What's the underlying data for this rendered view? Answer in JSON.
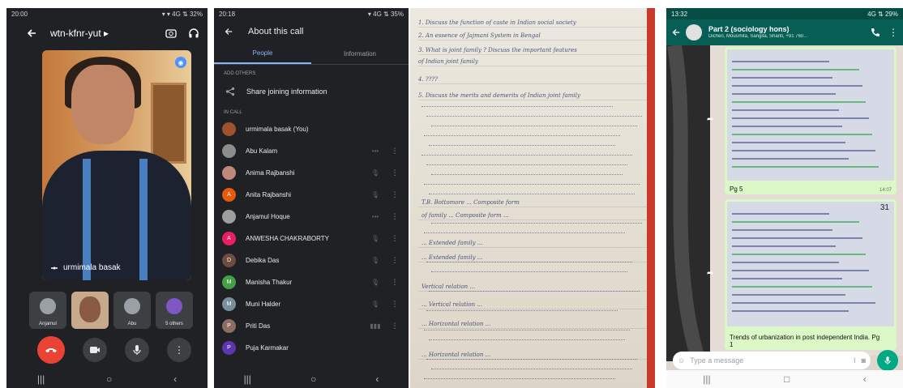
{
  "meet": {
    "status_time": "20:00",
    "status_right": "▾ ▾ 4G ⇅ 32%",
    "title": "wtn-kfnr-yut",
    "title_caret": "▸",
    "presenter_name": "urmimala basak",
    "thumbs": [
      {
        "label": "Anjamul"
      },
      {
        "label": "urmimala"
      },
      {
        "label": "Abu"
      },
      {
        "label": "5 others"
      }
    ]
  },
  "about": {
    "status_time": "20:18",
    "status_right": "▾ 4G ⇅ 35%",
    "title": "About this call",
    "tabs": [
      "People",
      "Information"
    ],
    "section_add": "ADD OTHERS",
    "share_label": "Share joining information",
    "section_incall": "IN CALL",
    "participants": [
      {
        "name": "urmimala basak (You)",
        "initial": "",
        "color": "#a0522d",
        "action": "",
        "menu": ""
      },
      {
        "name": "Abu Kalam",
        "initial": "",
        "color": "#8d8d8d",
        "action": "•••",
        "menu": "⋮"
      },
      {
        "name": "Anima Rajbanshi",
        "initial": "",
        "color": "#c0897a",
        "action": "🎙",
        "menu": "⋮"
      },
      {
        "name": "Anita Rajbanshi",
        "initial": "A",
        "color": "#e8590c",
        "action": "🎙",
        "menu": "⋮"
      },
      {
        "name": "Anjamul Hoque",
        "initial": "",
        "color": "#9e9e9e",
        "action": "•••",
        "menu": "⋮"
      },
      {
        "name": "ANWESHA CHAKRABORTY",
        "initial": "A",
        "color": "#e91e63",
        "action": "🎙",
        "menu": "⋮"
      },
      {
        "name": "Debika Das",
        "initial": "D",
        "color": "#6d4c41",
        "action": "🎙",
        "menu": "⋮"
      },
      {
        "name": "Manisha Thakur",
        "initial": "M",
        "color": "#43a047",
        "action": "🎙",
        "menu": "⋮"
      },
      {
        "name": "Muni Halder",
        "initial": "M",
        "color": "#78909c",
        "action": "🎙",
        "menu": "⋮"
      },
      {
        "name": "Priti Das",
        "initial": "P",
        "color": "#8d6e63",
        "action": "▮▮▮",
        "menu": "⋮"
      },
      {
        "name": "Puja Karmakar",
        "initial": "P",
        "color": "#5e35b1",
        "action": "",
        "menu": ""
      }
    ]
  },
  "notes": {
    "lines": [
      "1. Discuss the function of caste in Indian social society",
      "2. An essence of Jajmani System in Bengal",
      "3. What is joint family ? Discuss the important features",
      "   of Indian joint family",
      "4. ????",
      "5. Discuss the merits and demerits of Indian joint family",
      "T.B. Bottomore  ...  Composite form",
      "of family  ...  Composite form  ...",
      "... Extended family ...",
      "... Extended family ...",
      "Vertical relation ...",
      "... Vertical relation ...",
      "... Horizontal relation ...",
      "... Horizontal relation ..."
    ]
  },
  "whatsapp": {
    "status_time": "13:32",
    "status_right": "4G ⇅ 29%",
    "group_name": "Part 2 (sociology hons)",
    "members": "Dichen, Mousmita, Sangita, Shanti, +91 760...",
    "msg1_caption": "Pg 5",
    "msg1_time": "14:07",
    "msg2_num": "31",
    "msg2_caption": "Trends of urbanization in post independent India. Pg 1",
    "input_placeholder": "Type a message"
  }
}
